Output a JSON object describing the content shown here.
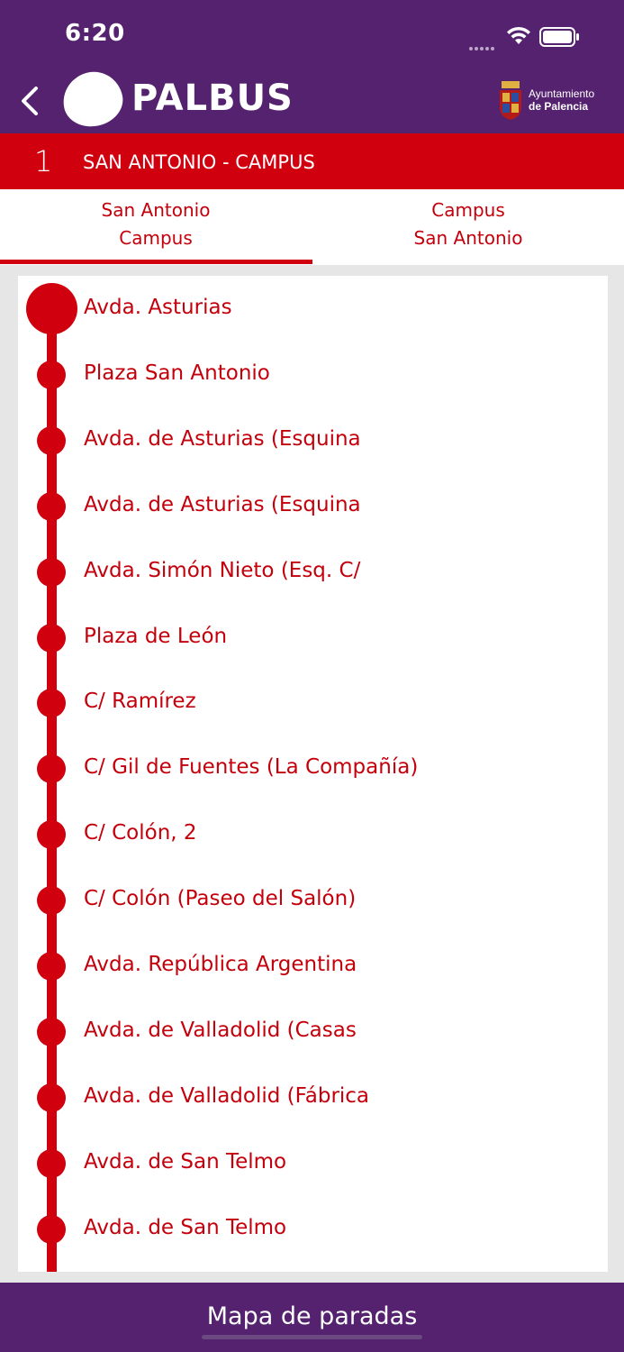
{
  "status_bar": {
    "time": "6:20"
  },
  "header": {
    "logo_text": "PALBUS",
    "ayto_line1": "Ayuntamiento",
    "ayto_line2": "de Palencia"
  },
  "route": {
    "number": "1",
    "name": "SAN ANTONIO - CAMPUS"
  },
  "tabs": [
    {
      "line1": "San Antonio",
      "line2": "Campus",
      "selected": true
    },
    {
      "line1": "Campus",
      "line2": "San Antonio",
      "selected": false
    }
  ],
  "stops": [
    "Avda. Asturias",
    "Plaza San Antonio",
    "Avda. de Asturias (Esquina",
    "Avda. de Asturias (Esquina",
    "Avda. Simón Nieto (Esq. C/",
    "Plaza de León",
    "C/ Ramírez",
    "C/ Gil de Fuentes (La Compañía)",
    "C/ Colón, 2",
    "C/ Colón (Paseo del Salón)",
    "Avda. República Argentina",
    "Avda. de Valladolid (Casas",
    "Avda. de Valladolid (Fábrica",
    "Avda. de San Telmo",
    "Avda. de San Telmo"
  ],
  "bottom": {
    "map_label": "Mapa de paradas"
  },
  "colors": {
    "header": "#55226f",
    "accent": "#d0000f",
    "text_red": "#c3000b"
  }
}
